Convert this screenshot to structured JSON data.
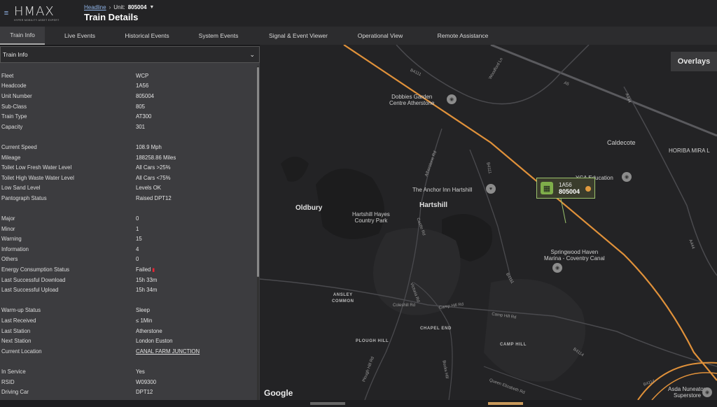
{
  "header": {
    "logo": "HMAX",
    "logo_sub": "HYPER MOBILITY ASSET EXPERT",
    "breadcrumb_link": "Headline",
    "unit_label": "Unit:",
    "unit_value": "805004",
    "title": "Train Details"
  },
  "tabs": [
    {
      "label": "Train Info"
    },
    {
      "label": "Live Events"
    },
    {
      "label": "Historical Events"
    },
    {
      "label": "System Events"
    },
    {
      "label": "Signal & Event Viewer"
    },
    {
      "label": "Operational View"
    },
    {
      "label": "Remote Assistance"
    }
  ],
  "panel": {
    "title": "Train Info",
    "group1": [
      {
        "k": "Fleet",
        "v": "WCP"
      },
      {
        "k": "Headcode",
        "v": "1A56"
      },
      {
        "k": "Unit Number",
        "v": "805004"
      },
      {
        "k": "Sub-Class",
        "v": "805"
      },
      {
        "k": "Train Type",
        "v": "AT300"
      },
      {
        "k": "Capacity",
        "v": "301"
      }
    ],
    "group2": [
      {
        "k": "Current Speed",
        "v": "108.9 Mph"
      },
      {
        "k": "Mileage",
        "v": "188258.86 Miles"
      },
      {
        "k": "Toilet Low Fresh Water Level",
        "v": "All Cars >25%"
      },
      {
        "k": "Toilet High Waste Water Level",
        "v": "All Cars <75%"
      },
      {
        "k": "Low Sand Level",
        "v": "Levels OK"
      },
      {
        "k": "Pantograph Status",
        "v": "Raised DPT12"
      }
    ],
    "group3": [
      {
        "k": "Major",
        "v": "0"
      },
      {
        "k": "Minor",
        "v": "1"
      },
      {
        "k": "Warning",
        "v": "15"
      },
      {
        "k": "Information",
        "v": "4"
      },
      {
        "k": "Others",
        "v": "0"
      },
      {
        "k": "Energy Consumption Status",
        "v": "Failed"
      },
      {
        "k": "Last Successful Download",
        "v": "15h 33m"
      },
      {
        "k": "Last Successful Upload",
        "v": "15h 34m"
      }
    ],
    "group4": [
      {
        "k": "Warm-up Status",
        "v": "Sleep"
      },
      {
        "k": "Last Received",
        "v": "≤ 1Min"
      },
      {
        "k": "Last Station",
        "v": "Atherstone"
      },
      {
        "k": "Next Station",
        "v": "London Euston"
      },
      {
        "k": "Current Location",
        "v": "CANAL FARM JUNCTION"
      }
    ],
    "group5": [
      {
        "k": "In Service",
        "v": "Yes"
      },
      {
        "k": "RSID",
        "v": "W09300"
      },
      {
        "k": "Driving Car",
        "v": "DPT12"
      }
    ]
  },
  "map": {
    "overlays_label": "Overlays",
    "train_headcode": "1A56",
    "train_unit": "805004",
    "google": "Google",
    "places": {
      "dobbies": "Dobbies Garden\nCentre Atherstone",
      "caldecote": "Caldecote",
      "horiba": "HORIBA MIRA L",
      "yca": "YCA Education",
      "anchor": "The Anchor Inn Hartshill",
      "oldbury": "Oldbury",
      "hartshill_hayes": "Hartshill Hayes\nCountry Park",
      "hartshill": "Hartshill",
      "springwood": "Springwood Haven\nMarina - Coventry Canal",
      "ansley": "ANSLEY\nCOMMON",
      "chapel_end": "CHAPEL END",
      "plough_hill": "PLOUGH HILL",
      "camp_hill": "CAMP HILL",
      "asda": "Asda Nuneaton\nSuperstore"
    },
    "roads": {
      "b4111a": "B4111",
      "b4111b": "B4111",
      "b4111c": "B4111",
      "a5": "A5",
      "a444a": "A444",
      "a444b": "A444",
      "woodford": "Woodford Ln",
      "atherstone_rd": "Atherstone Rd",
      "castle_rd": "Castle Rd",
      "victoria_rd": "Victoria Rd",
      "coleshill": "Coleshill Rd",
      "camp_hill_rd1": "Camp Hill Rd",
      "camp_hill_rd2": "Camp Hill Rd",
      "b4114a": "B4114",
      "b4114b": "B4114",
      "plough_hill_rd": "Plough Hill Rd",
      "bucks_hill": "Bucks Hill",
      "queen_eliz": "Queen Elizabeth Rd"
    }
  },
  "colors": {
    "accent_link": "#8fb3e6",
    "rail_line": "#e0913a",
    "train_marker": "#7fae4a",
    "failed_flag": "#e22233"
  }
}
